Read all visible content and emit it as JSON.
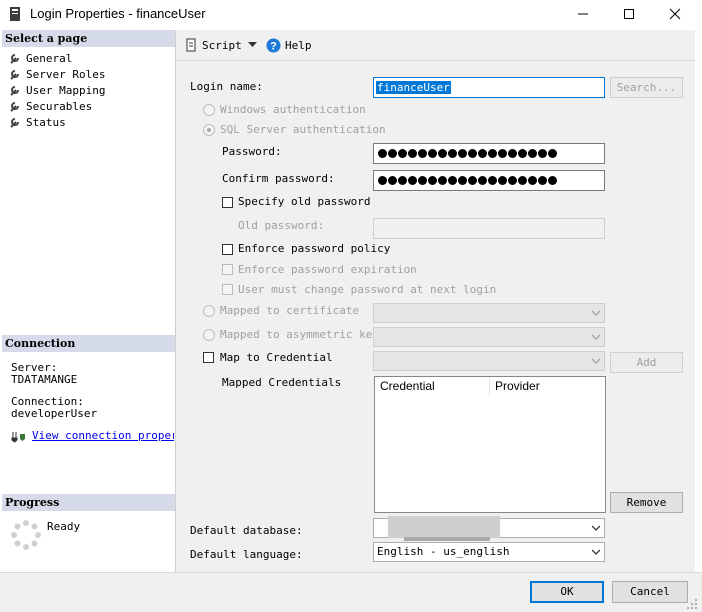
{
  "window": {
    "title": "Login Properties - financeUser"
  },
  "sidebar": {
    "select_header": "Select a page",
    "pages": [
      {
        "label": "General"
      },
      {
        "label": "Server Roles"
      },
      {
        "label": "User Mapping"
      },
      {
        "label": "Securables"
      },
      {
        "label": "Status"
      }
    ],
    "connection_header": "Connection",
    "server_label": "Server:",
    "server_value": "TDATAMANGE",
    "connection_label": "Connection:",
    "connection_value": "developerUser",
    "view_props_link": "View connection properti",
    "progress_header": "Progress",
    "progress_status": "Ready"
  },
  "toolbar": {
    "script_label": "Script",
    "help_label": "Help"
  },
  "form": {
    "login_name_label": "Login name:",
    "login_name_value": "financeUser",
    "search_button": "Search...",
    "windows_auth": "Windows authentication",
    "sql_auth": "SQL Server authentication",
    "password_label": "Password:",
    "confirm_password_label": "Confirm password:",
    "specify_old_password": "Specify old password",
    "old_password_label": "Old password:",
    "enforce_policy": "Enforce password policy",
    "enforce_expiration": "Enforce password expiration",
    "must_change": "User must change password at next login",
    "mapped_to_certificate": "Mapped to certificate",
    "mapped_to_asym_key": "Mapped to asymmetric key",
    "map_to_credential": "Map to Credential",
    "add_button": "Add",
    "mapped_credentials_label": "Mapped Credentials",
    "credentials_columns": [
      "Credential",
      "Provider"
    ],
    "remove_button": "Remove",
    "default_database_label": "Default database:",
    "default_language_label": "Default language:",
    "default_language_value": "English - us_english"
  },
  "footer": {
    "ok_button": "OK",
    "cancel_button": "Cancel"
  },
  "colors": {
    "section_header_bg": "#d6dbe9",
    "selection_bg": "#0078d7",
    "link": "#0000ee",
    "ok_border": "#0078d7"
  },
  "icons": [
    "app-icon",
    "minimize-icon",
    "maximize-icon",
    "close-icon",
    "wrench-icon",
    "script-icon",
    "dropdown-icon",
    "help-icon",
    "plug-icon",
    "spinner-icon",
    "chevron-down-icon"
  ]
}
